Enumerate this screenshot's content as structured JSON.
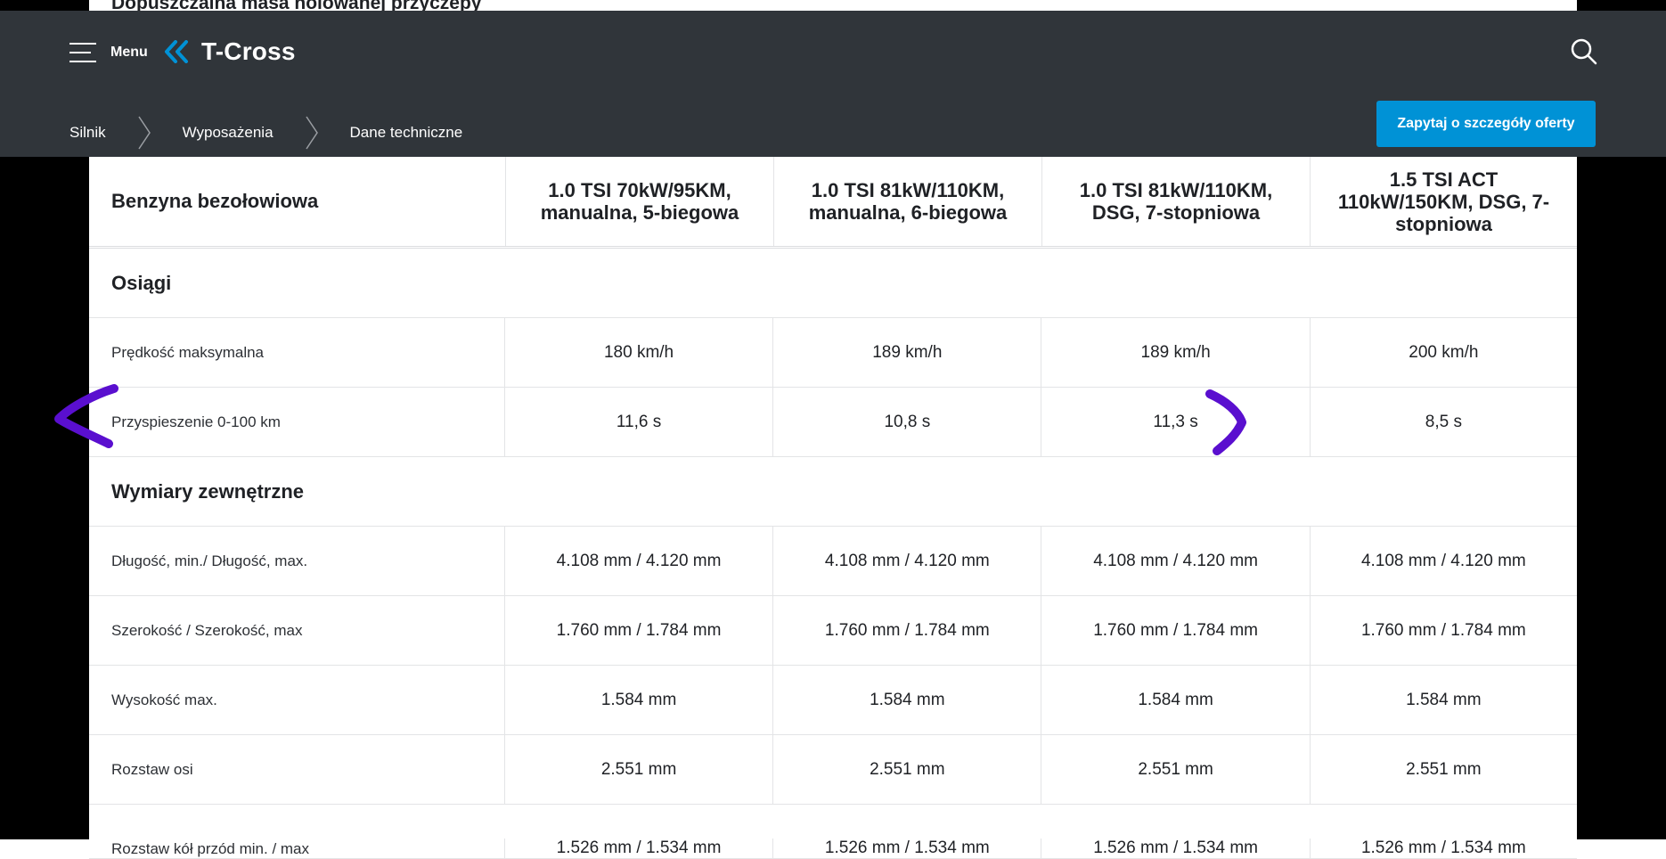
{
  "page": {
    "top_cut_text": "Dopuszczalna masa holowanej przyczepy"
  },
  "header": {
    "menu_label": "Menu",
    "brand_title": "T-Cross",
    "breadcrumbs": [
      "Silnik",
      "Wyposażenia",
      "Dane techniczne"
    ],
    "cta_label": "Zapytaj o szczegóły oferty"
  },
  "colors": {
    "header_bg": "#30353a",
    "accent_blue": "#0092d6",
    "annotation_purple": "#5a0fcf"
  },
  "icons": [
    "menu-icon",
    "chevron-left-double-icon",
    "search-icon",
    "breadcrumb-chevron-icon"
  ],
  "table": {
    "header_label": "Benzyna bezołowiowa",
    "columns": [
      [
        "1.0 TSI 70kW/95KM,",
        "manualna, 5-biegowa"
      ],
      [
        "1.0 TSI 81kW/110KM,",
        "manualna, 6-biegowa"
      ],
      [
        "1.0 TSI 81kW/110KM,",
        "DSG, 7-stopniowa"
      ],
      [
        "1.5 TSI ACT",
        "110kW/150KM, DSG, 7-",
        "stopniowa"
      ]
    ],
    "sections": {
      "performance": {
        "title": "Osiągi",
        "rows": [
          {
            "label": "Prędkość maksymalna",
            "values": [
              "180 km/h",
              "189 km/h",
              "189 km/h",
              "200 km/h"
            ]
          },
          {
            "label": "Przyspieszenie 0-100 km",
            "values": [
              "11,6 s",
              "10,8 s",
              "11,3 s",
              "8,5 s"
            ]
          }
        ]
      },
      "dimensions": {
        "title": "Wymiary zewnętrzne",
        "rows": [
          {
            "label": "Długość, min./ Długość, max.",
            "values": [
              "4.108 mm / 4.120 mm",
              "4.108 mm / 4.120 mm",
              "4.108 mm / 4.120 mm",
              "4.108 mm / 4.120 mm"
            ]
          },
          {
            "label": "Szerokość / Szerokość, max",
            "values": [
              "1.760 mm / 1.784 mm",
              "1.760 mm / 1.784 mm",
              "1.760 mm / 1.784 mm",
              "1.760 mm / 1.784 mm"
            ]
          },
          {
            "label": "Wysokość max.",
            "values": [
              "1.584 mm",
              "1.584 mm",
              "1.584 mm",
              "1.584 mm"
            ]
          },
          {
            "label": "Rozstaw osi",
            "values": [
              "2.551 mm",
              "2.551 mm",
              "2.551 mm",
              "2.551 mm"
            ]
          },
          {
            "label": "Rozstaw kół przód min. / max",
            "values": [
              "1.526 mm / 1.534 mm",
              "1.526 mm / 1.534 mm",
              "1.526 mm / 1.534 mm",
              "1.526 mm / 1.534 mm"
            ]
          }
        ]
      }
    }
  }
}
